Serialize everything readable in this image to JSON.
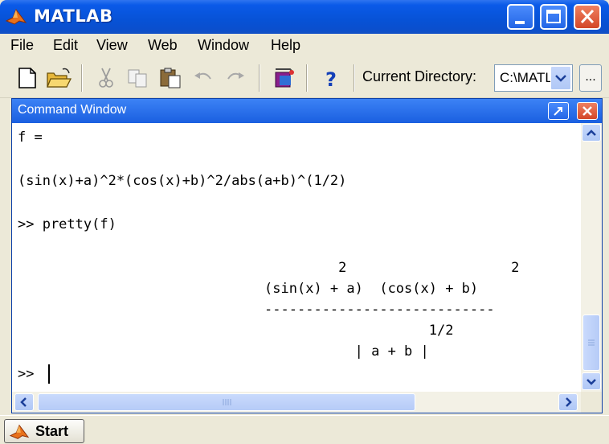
{
  "window": {
    "title": "MATLAB"
  },
  "menu": [
    "File",
    "Edit",
    "View",
    "Web",
    "Window",
    "Help"
  ],
  "toolbar": {
    "current_directory_label": "Current Directory:",
    "current_directory_value": "C:\\MATLAB",
    "browse_label": "..."
  },
  "command_window": {
    "title": "Command Window",
    "lines": [
      "f =",
      "(sin(x)+a)^2*(cos(x)+b)^2/abs(a+b)^(1/2)",
      ">> pretty(f)",
      "                                       2                    2",
      "                              (sin(x) + a)  (cos(x) + b)",
      "                              ----------------------------",
      "                                                  1/2",
      "                                         | a + b |",
      ">> "
    ]
  },
  "startbar": {
    "start_label": "Start"
  },
  "icons": {
    "app": "matlab-logo-icon",
    "minimize": "minimize-icon",
    "maximize": "maximize-icon",
    "close": "close-icon",
    "new": "new-file-icon",
    "open": "open-folder-icon",
    "cut": "cut-icon",
    "copy": "copy-icon",
    "paste": "paste-icon",
    "undo": "undo-icon",
    "redo": "redo-icon",
    "simulink": "simulink-icon",
    "help": "help-icon"
  }
}
